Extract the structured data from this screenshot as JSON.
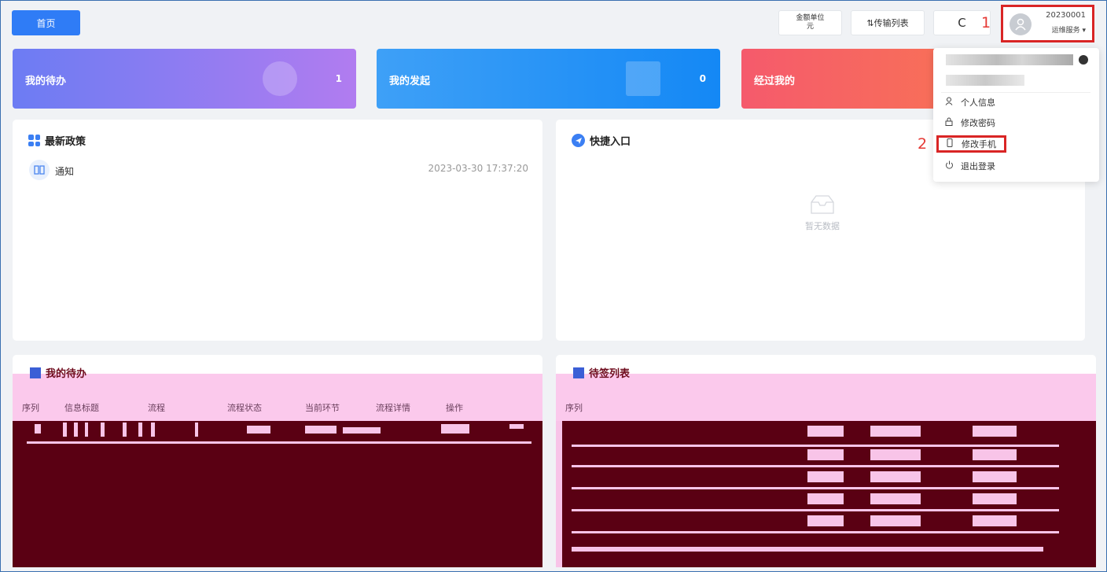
{
  "topbar": {
    "home_label": "首页",
    "unit_line1": "金额单位",
    "unit_line2": "元",
    "transfer_label": "⇅传输列表",
    "refresh_icon": "C",
    "annotation_1": "1",
    "user_id": "20230001",
    "user_role": "运维服务 ▾"
  },
  "stats": {
    "todo_label": "我的待办",
    "todo_count": "1",
    "init_label": "我的发起",
    "init_count": "0",
    "pass_label": "经过我的"
  },
  "policy": {
    "title": "最新政策",
    "items": [
      {
        "text": "通知",
        "time": "2023-03-30 17:37:20"
      }
    ]
  },
  "quick": {
    "title": "快捷入口",
    "empty_text": "暂无数据"
  },
  "todo_list": {
    "title": "我的待办",
    "columns": [
      "序列",
      "信息标题",
      "流程",
      "流程状态",
      "当前环节",
      "流程详情",
      "操作"
    ]
  },
  "wait_list": {
    "title": "待签列表",
    "columns": [
      "序列"
    ]
  },
  "menu": {
    "items": [
      {
        "icon": "person",
        "label": "个人信息"
      },
      {
        "icon": "lock",
        "label": "修改密码"
      },
      {
        "icon": "phone",
        "label": "修改手机"
      },
      {
        "icon": "power",
        "label": "退出登录"
      }
    ],
    "annotation_2": "2"
  },
  "colors": {
    "primary": "#2f7cf6",
    "highlight": "#d92525",
    "glitch_dark": "#5a0013",
    "glitch_pink": "#f8c4e8"
  }
}
